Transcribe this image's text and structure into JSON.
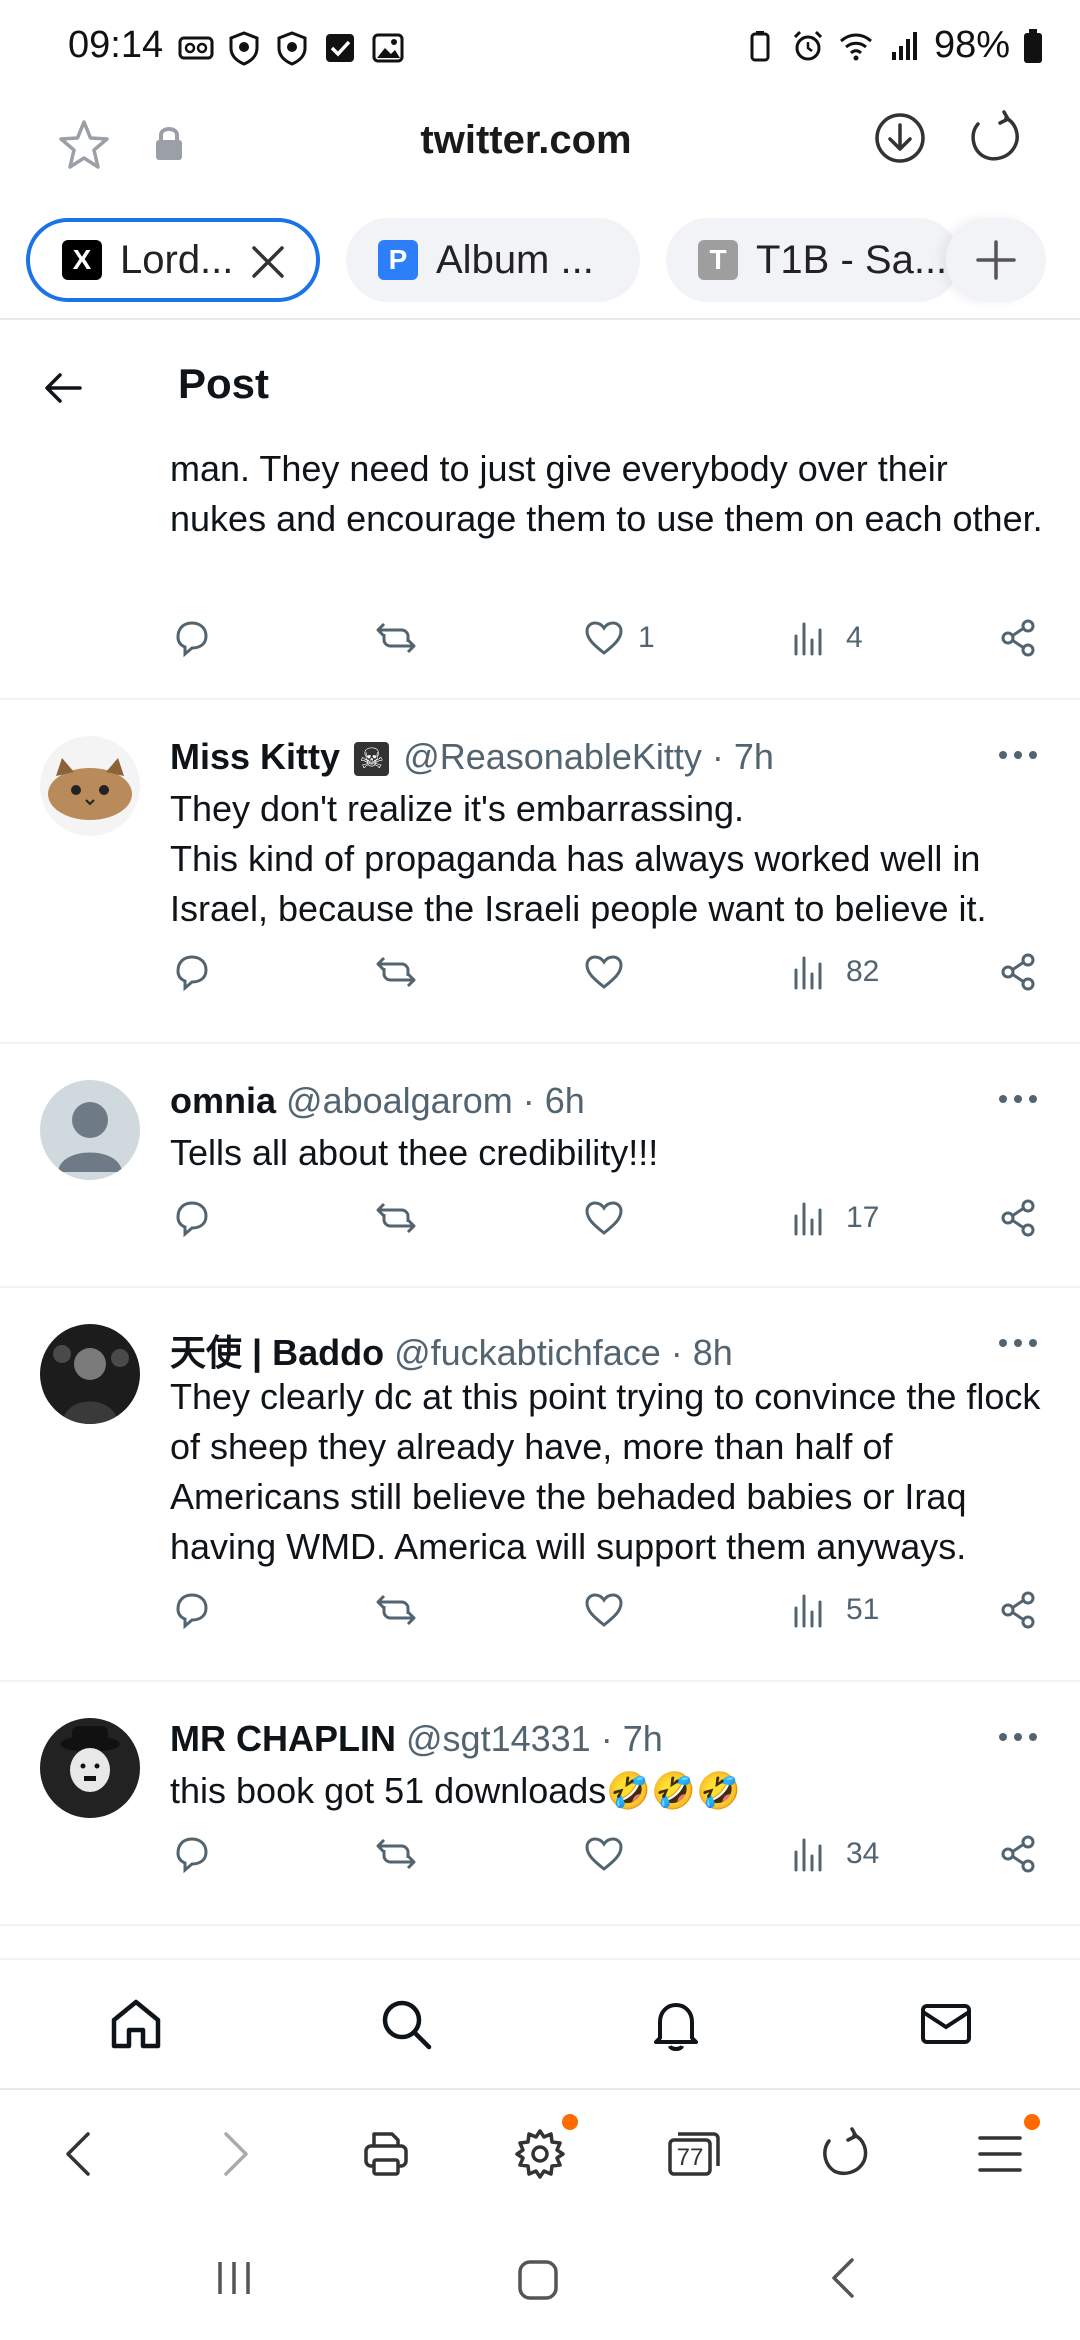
{
  "status_bar": {
    "time": "09:14",
    "battery": "98%"
  },
  "browser": {
    "url": "twitter.com",
    "tabs": [
      {
        "label": "Lord...",
        "favicon": "X",
        "favicon_color": "#000000",
        "active": true
      },
      {
        "label": "Album ...",
        "favicon": "P",
        "favicon_color": "#2d7ff9",
        "active": false
      },
      {
        "label": "T1B - Sa...",
        "favicon": "T",
        "favicon_color": "#9e9e9e",
        "active": false
      }
    ],
    "tab_count": "77"
  },
  "header": {
    "title": "Post"
  },
  "partial_tweet": {
    "text": "man. They need to just give everybody over their nukes and encourage them to use them on each other.",
    "likes": "1",
    "views": "4"
  },
  "tweets": [
    {
      "name": "Miss Kitty",
      "name_badge": "☠",
      "handle": "@ReasonableKitty",
      "time": "· 7h",
      "text_line1": "They don't realize it's embarrassing.",
      "text_line2": "This kind of propaganda has always worked well in Israel, because the Israeli people want to believe it.",
      "views": "82"
    },
    {
      "name": "omnia",
      "handle": "@aboalgarom",
      "time": "· 6h",
      "text": "Tells all about thee credibility!!!",
      "views": "17"
    },
    {
      "name": "天使 | Baddo",
      "handle": "@fuckabtichface",
      "time": "· 8h",
      "text": "They clearly dc at this point trying to convince the flock of sheep they already have, more than half of Americans still believe the behaded babies or Iraq having WMD. America will support them anyways.",
      "views": "51"
    },
    {
      "name": "MR CHAPLIN",
      "handle": "@sgt14331",
      "time": "· 7h",
      "text": "this book got 51 downloads🤣🤣🤣",
      "views": "34"
    }
  ],
  "colors": {
    "accent": "#1a73e8",
    "text": "#0f1419",
    "muted": "#536471",
    "notify_dot": "#ff6a00"
  }
}
